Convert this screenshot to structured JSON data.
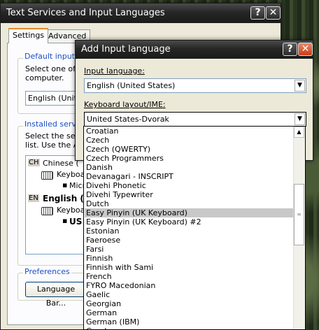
{
  "main_window": {
    "title": "Text Services and Input Languages",
    "tabs": [
      "Settings",
      "Advanced"
    ],
    "default_group_label": "Default input lar",
    "default_desc": [
      "Select one of th",
      "computer."
    ],
    "default_combo_value": "English (United",
    "installed_group_label": "Installed service",
    "installed_desc": [
      "Select the serv",
      "list. Use the Ad"
    ],
    "tree": {
      "ch_code": "CH",
      "ch_label": "Chinese (",
      "ch_keyboard": "Keyboar",
      "ch_micro": "Micr",
      "en_code": "EN",
      "en_label": "English (U",
      "en_keyboard": "Keyboar",
      "en_us": "US"
    },
    "preferences_label": "Preferences",
    "language_bar_button": "Language Bar..."
  },
  "dialog": {
    "title": "Add Input language",
    "input_language_label": "Input language:",
    "input_language_value": "English (United States)",
    "keyboard_layout_label": "Keyboard layout/IME:",
    "keyboard_layout_value": "United States-Dvorak",
    "options": [
      "Croatian",
      "Czech",
      "Czech (QWERTY)",
      "Czech Programmers",
      "Danish",
      "Devanagari - INSCRIPT",
      "Divehi Phonetic",
      "Divehi Typewriter",
      "Dutch",
      "Easy Pinyin (UK Keyboard)",
      "Easy Pinyin (UK Keyboard) #2",
      "Estonian",
      "Faeroese",
      "Farsi",
      "Finnish",
      "Finnish with Sami",
      "French",
      "FYRO Macedonian",
      "Gaelic",
      "Georgian",
      "German",
      "German (IBM)",
      "Greek"
    ],
    "selected_index": 9
  }
}
